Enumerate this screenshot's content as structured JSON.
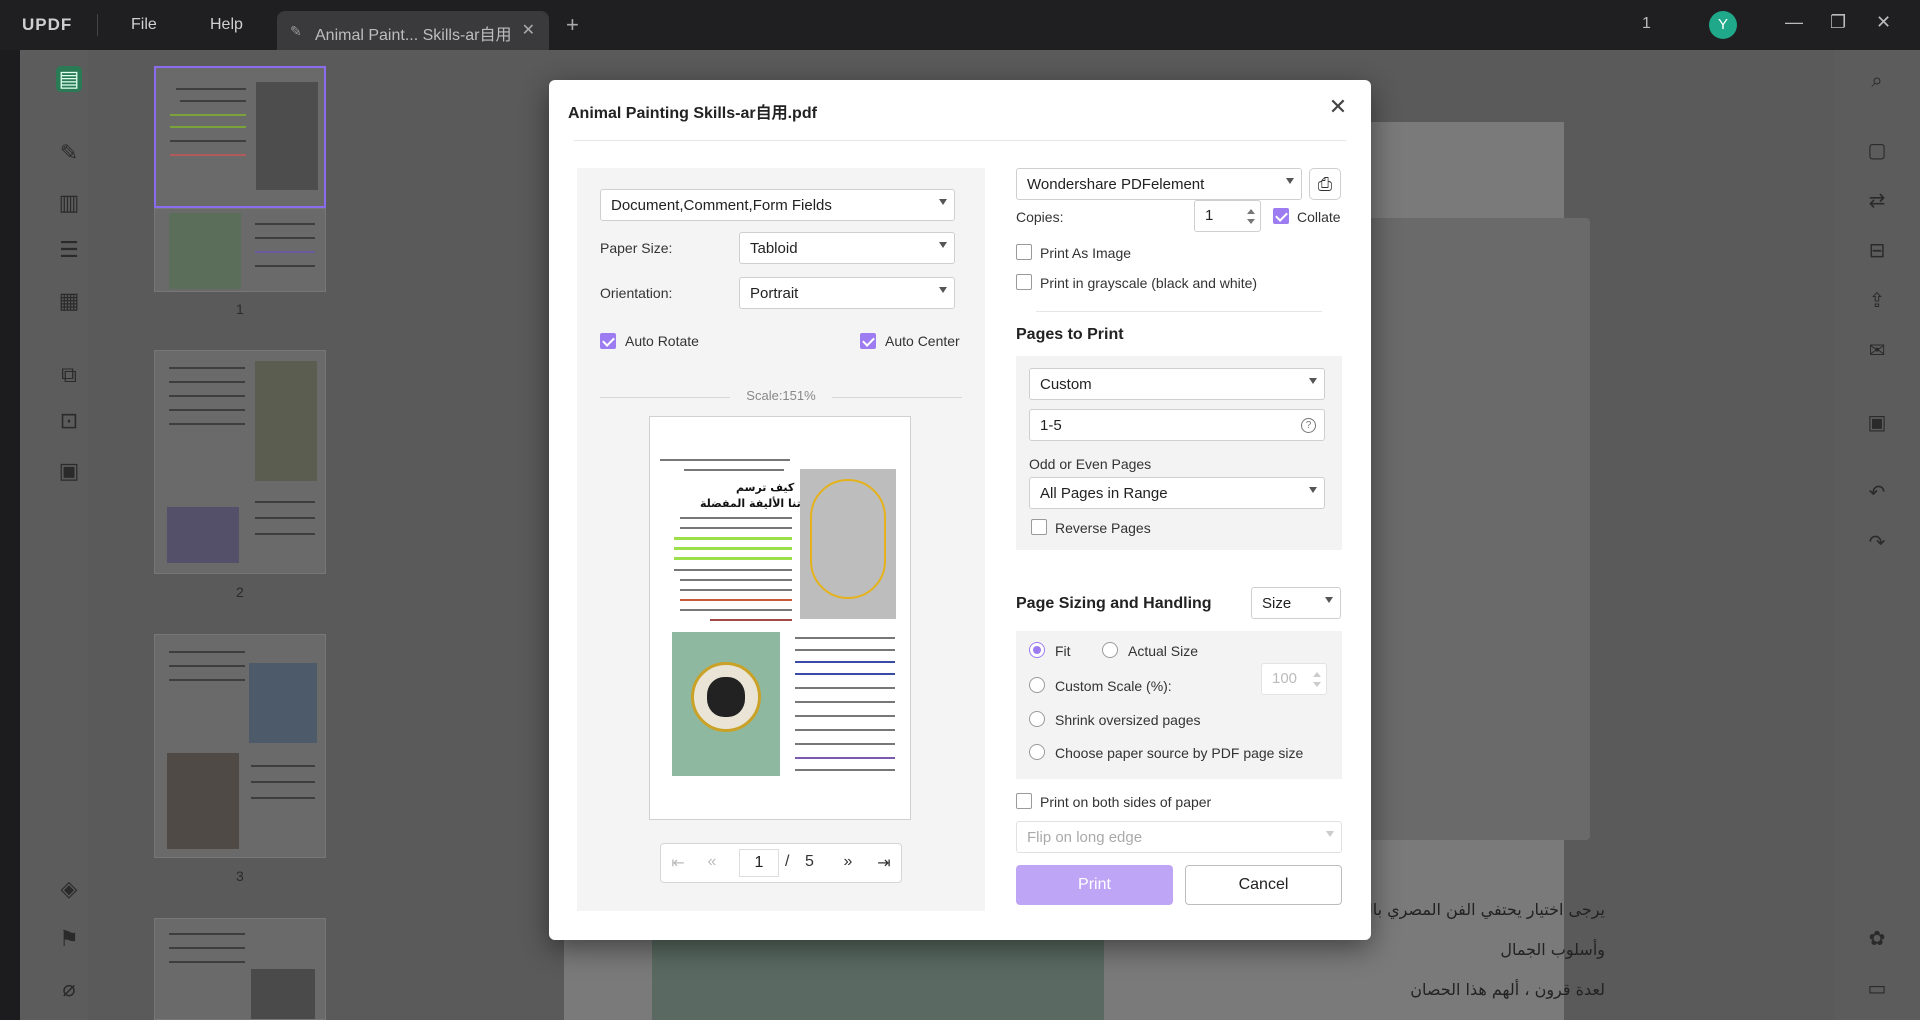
{
  "titlebar": {
    "logo": "UPDF",
    "menu_file": "File",
    "menu_help": "Help",
    "tab_title": "Animal Paint... Skills-ar自用",
    "tab_close": "✕",
    "add_tab": "+",
    "window_count": "1",
    "avatar_letter": "Y",
    "minimize": "—",
    "restore": "❐",
    "close": "✕"
  },
  "document": {
    "arabic_lines": [
      "يرجى اختيار يحتفي الفن المصري بال",
      "وأسلوب الجمال",
      "لعدة قرون ، ألهم هذا الحصان"
    ]
  },
  "thumbnails": {
    "page_numbers": [
      "1",
      "2",
      "3"
    ]
  },
  "dialog": {
    "title": "Animal Painting Skills-ar自用.pdf",
    "close": "✕",
    "content_select": "Document,Comment,Form Fields",
    "paper_size_label": "Paper Size:",
    "paper_size_value": "Tabloid",
    "orientation_label": "Orientation:",
    "orientation_value": "Portrait",
    "auto_rotate_label": "Auto Rotate",
    "auto_rotate_checked": true,
    "auto_center_label": "Auto Center",
    "auto_center_checked": true,
    "scale_text": "Scale:151%",
    "preview_title_1": "كيف ترسم",
    "preview_title_2": "حيواناتنا الأليفة المفضلة",
    "pager": {
      "current": "1",
      "separator": "/",
      "total": "5",
      "first": "⇤",
      "prev": "«",
      "next": "»",
      "last": "⇥"
    },
    "printer_value": "Wondershare PDFelement",
    "copies_label": "Copies:",
    "copies_value": "1",
    "collate_label": "Collate",
    "collate_checked": true,
    "print_as_image_label": "Print As Image",
    "grayscale_label": "Print in grayscale (black and white)",
    "pages_to_print_title": "Pages to Print",
    "pages_mode_value": "Custom",
    "pages_range_value": "1-5",
    "odd_even_label": "Odd or Even Pages",
    "odd_even_value": "All Pages in Range",
    "reverse_pages_label": "Reverse Pages",
    "sizing_title": "Page Sizing and Handling",
    "sizing_mode_value": "Size",
    "fit_label": "Fit",
    "actual_size_label": "Actual Size",
    "custom_scale_label": "Custom Scale (%):",
    "custom_scale_value": "100",
    "shrink_label": "Shrink oversized pages",
    "paper_source_label": "Choose paper source by PDF page size",
    "both_sides_label": "Print on both sides of paper",
    "flip_value": "Flip on long edge",
    "print_button": "Print",
    "cancel_button": "Cancel"
  },
  "colors": {
    "accent": "#9c7cf0",
    "print_button": "#bfa5f5",
    "avatar": "#1fa88a"
  }
}
